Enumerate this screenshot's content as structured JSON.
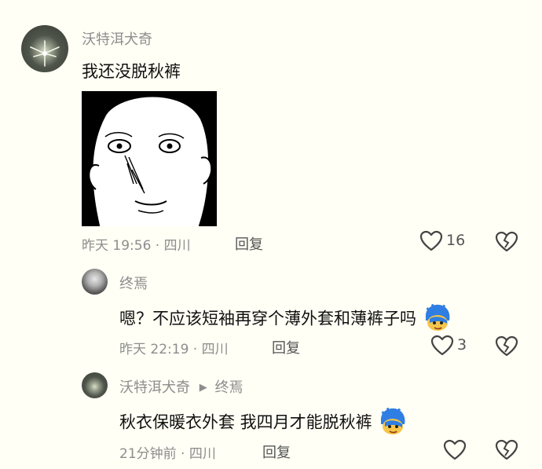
{
  "comment": {
    "username": "沃特洱犬奇",
    "text": "我还没脱秋裤",
    "meta": "昨天 19:56 · 四川",
    "reply_label": "回复",
    "like_count": "16"
  },
  "replies": [
    {
      "username": "终焉",
      "text": "嗯？不应该短袖再穿个薄外套和薄裤子吗",
      "emoji": "blue-face-emoji",
      "meta": "昨天 22:19 · 四川",
      "reply_label": "回复",
      "like_count": "3"
    },
    {
      "username": "沃特洱犬奇",
      "reply_to": "终焉",
      "text": "秋衣保暖衣外套 我四月才能脱秋裤",
      "emoji": "blue-face-emoji",
      "meta": "21分钟前 · 四川",
      "reply_label": "回复"
    }
  ],
  "icons": {
    "like": "heart-outline-icon",
    "dislike": "broken-heart-icon",
    "reply_arrow": "triangle-right-icon"
  },
  "colors": {
    "background": "#fffff5",
    "secondary_text": "#8d8d8d",
    "emoji_blue": "#2f7ee3"
  }
}
